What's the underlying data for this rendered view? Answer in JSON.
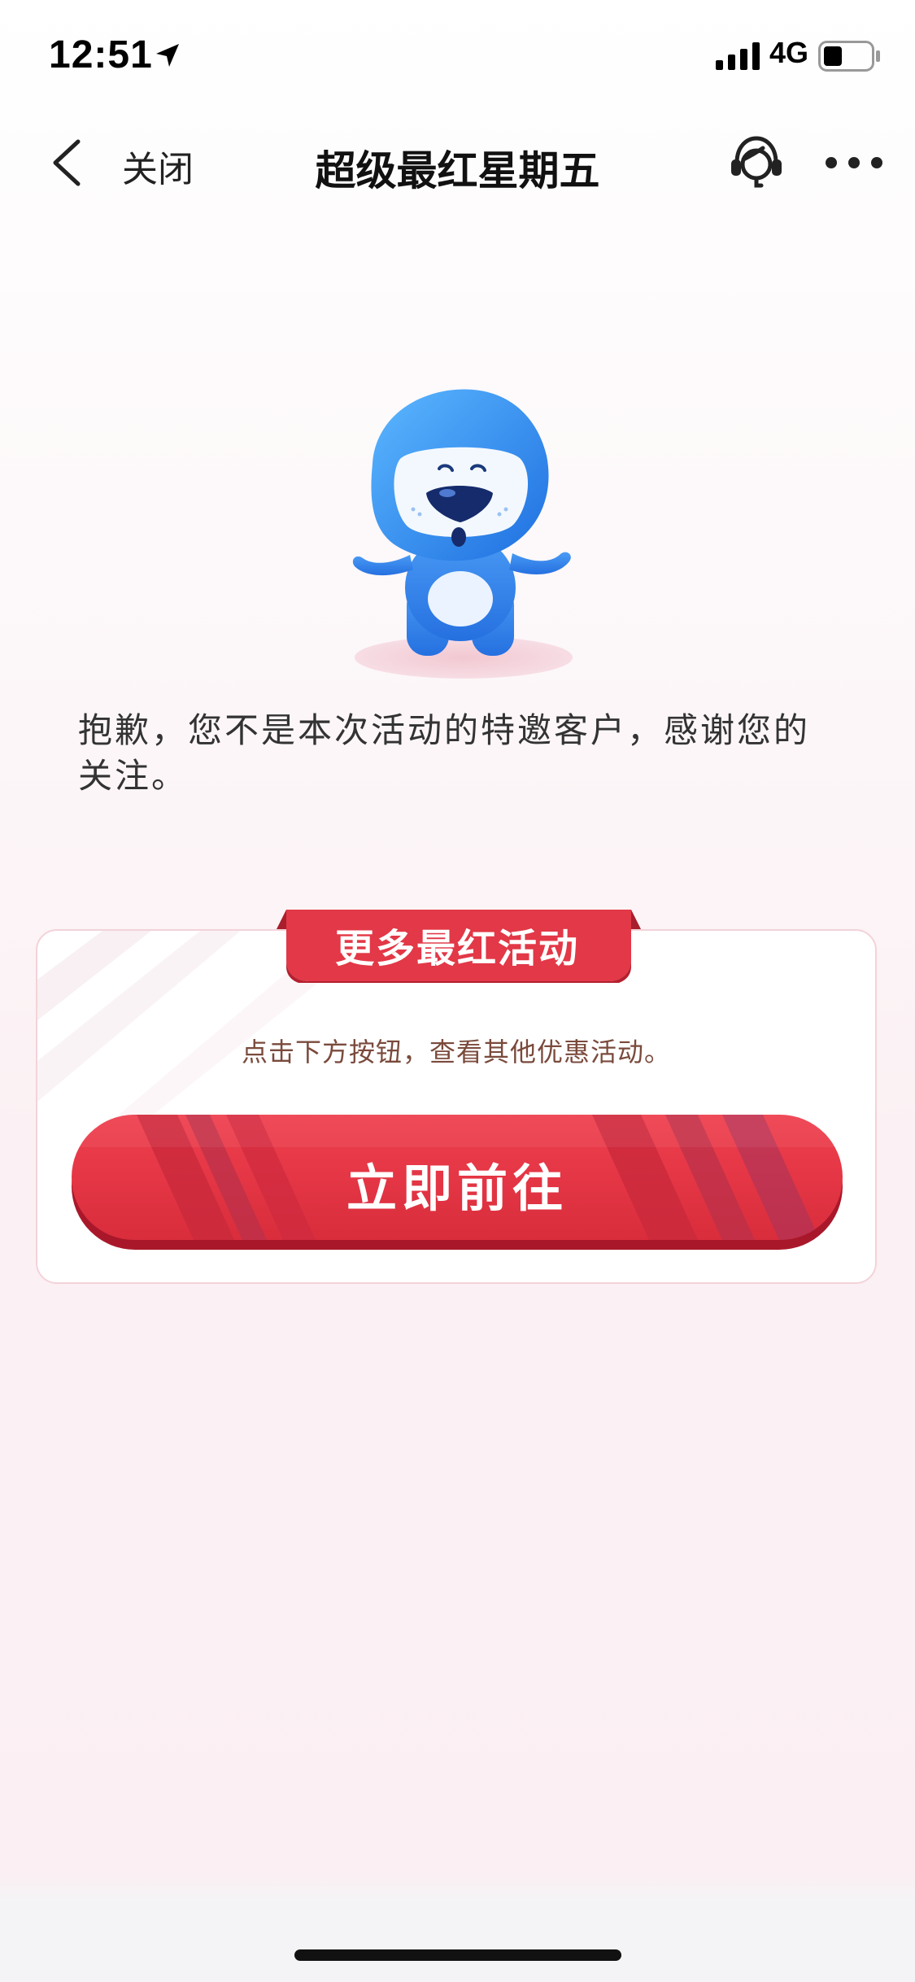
{
  "status_bar": {
    "time": "12:51",
    "network": "4G",
    "icons": [
      "location-arrow-icon",
      "signal-bars-icon",
      "battery-icon"
    ]
  },
  "nav": {
    "back_icon": "chevron-left-icon",
    "close_label": "关闭",
    "title": "超级最红星期五",
    "service_icon": "customer-service-icon",
    "more_icon": "more-dots-icon"
  },
  "mascot": {
    "icon": "blue-lion-mascot",
    "color": "#3a8ef0"
  },
  "message": {
    "text": "抱歉，您不是本次活动的特邀客户，感谢您的关注。"
  },
  "promo_card": {
    "title": "更多最红活动",
    "hint": "点击下方按钮，查看其他优惠活动。",
    "button_label": "立即前往",
    "accent_color": "#e23847"
  }
}
